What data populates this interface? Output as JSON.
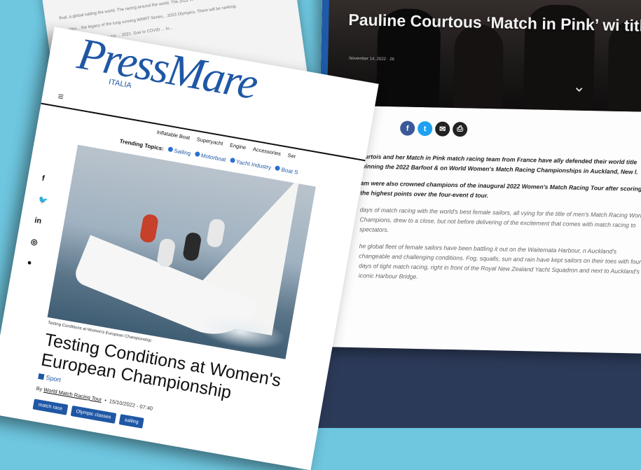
{
  "back_clipping": {
    "lines": [
      "final, a global sailing the world. The racing around the world. The 2022 W",
      "The Wor... the legacy of the long running WMRT Series... 2023 Olympics. There will be ranking.",
      "Match... from France, the top ... 2021. Due to COVID ... to..."
    ]
  },
  "article": {
    "hero_title": "Pauline Courtous ‘Match in Pink’ wi title",
    "hero_meta": "November 14, 2022 · 26",
    "share_icons": [
      "facebook-icon",
      "twitter-icon",
      "email-icon",
      "print-icon"
    ],
    "paragraphs": [
      {
        "style": "b",
        "text": "ourtois and her Match in Pink match racing team from France have ally defended their world title winning the 2022 Barfoot & on World Women's Match Racing Championships in Auckland, New l."
      },
      {
        "style": "b",
        "text": "am were also crowned champions of the inaugural 2022 Women's Match Racing Tour after scoring the highest points over the four-event d tour."
      },
      {
        "style": "i",
        "text": "days of match racing with the world's best female sailors, all vying for the title of men's Match Racing World Champions, drew to a close, but not before delivering of the excitement that comes with match racing to spectators."
      },
      {
        "style": "i",
        "text": "he global fleet of female sailors have been battling it out on the Waitemata Harbour, n Auckland's changeable and challenging conditions. Fog, squalls, sun and rain have kept sailors on their toes with four days of tight match racing, right in front of the Royal New Zealand Yacht Squadron and next to Auckland's iconic Harbour Bridge."
      }
    ]
  },
  "press": {
    "logo": "PressMare",
    "logo_sub": "ITALIA",
    "menu_icon": "≡",
    "nav": [
      "Inflatable Boat",
      "Superyacht",
      "Engine",
      "Accessories",
      "Ser"
    ],
    "trending_label": "Trending Topics:",
    "trending": [
      "Sailing",
      "Motorboat",
      "Yacht Industry",
      "Boat S"
    ],
    "photo_caption": "Testing Conditions at Women's European Championship",
    "social": [
      "f",
      "🐦",
      "in",
      "◎",
      "●"
    ],
    "title": "Testing Conditions at Women's European Championship",
    "category": "Sport",
    "byline_prefix": "By",
    "author": "World Match Racing Tour",
    "date": "15/10/2022 - 07:40",
    "tags": [
      "match race",
      "Olympic classes",
      "sailing"
    ]
  },
  "colors": {
    "accent": "#1f57a5",
    "background": "#6ec6df",
    "dark": "#2c3a59"
  }
}
